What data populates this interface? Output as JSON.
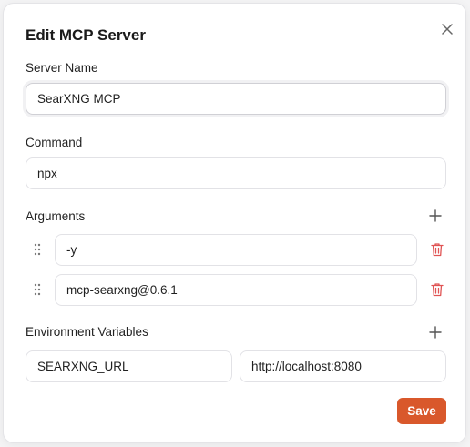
{
  "dialog": {
    "title": "Edit MCP Server",
    "close_icon": "close-icon"
  },
  "server_name": {
    "label": "Server Name",
    "value": "SearXNG MCP"
  },
  "command": {
    "label": "Command",
    "value": "npx"
  },
  "arguments": {
    "label": "Arguments",
    "items": [
      "-y",
      "mcp-searxng@0.6.1"
    ]
  },
  "env": {
    "label": "Environment Variables",
    "items": [
      {
        "key": "SEARXNG_URL",
        "value": "http://localhost:8080"
      }
    ]
  },
  "save_label": "Save",
  "colors": {
    "accent": "#d9582b",
    "delete": "#e05353"
  },
  "icons": [
    "close-icon",
    "plus-icon",
    "drag-handle-icon",
    "trash-icon"
  ]
}
